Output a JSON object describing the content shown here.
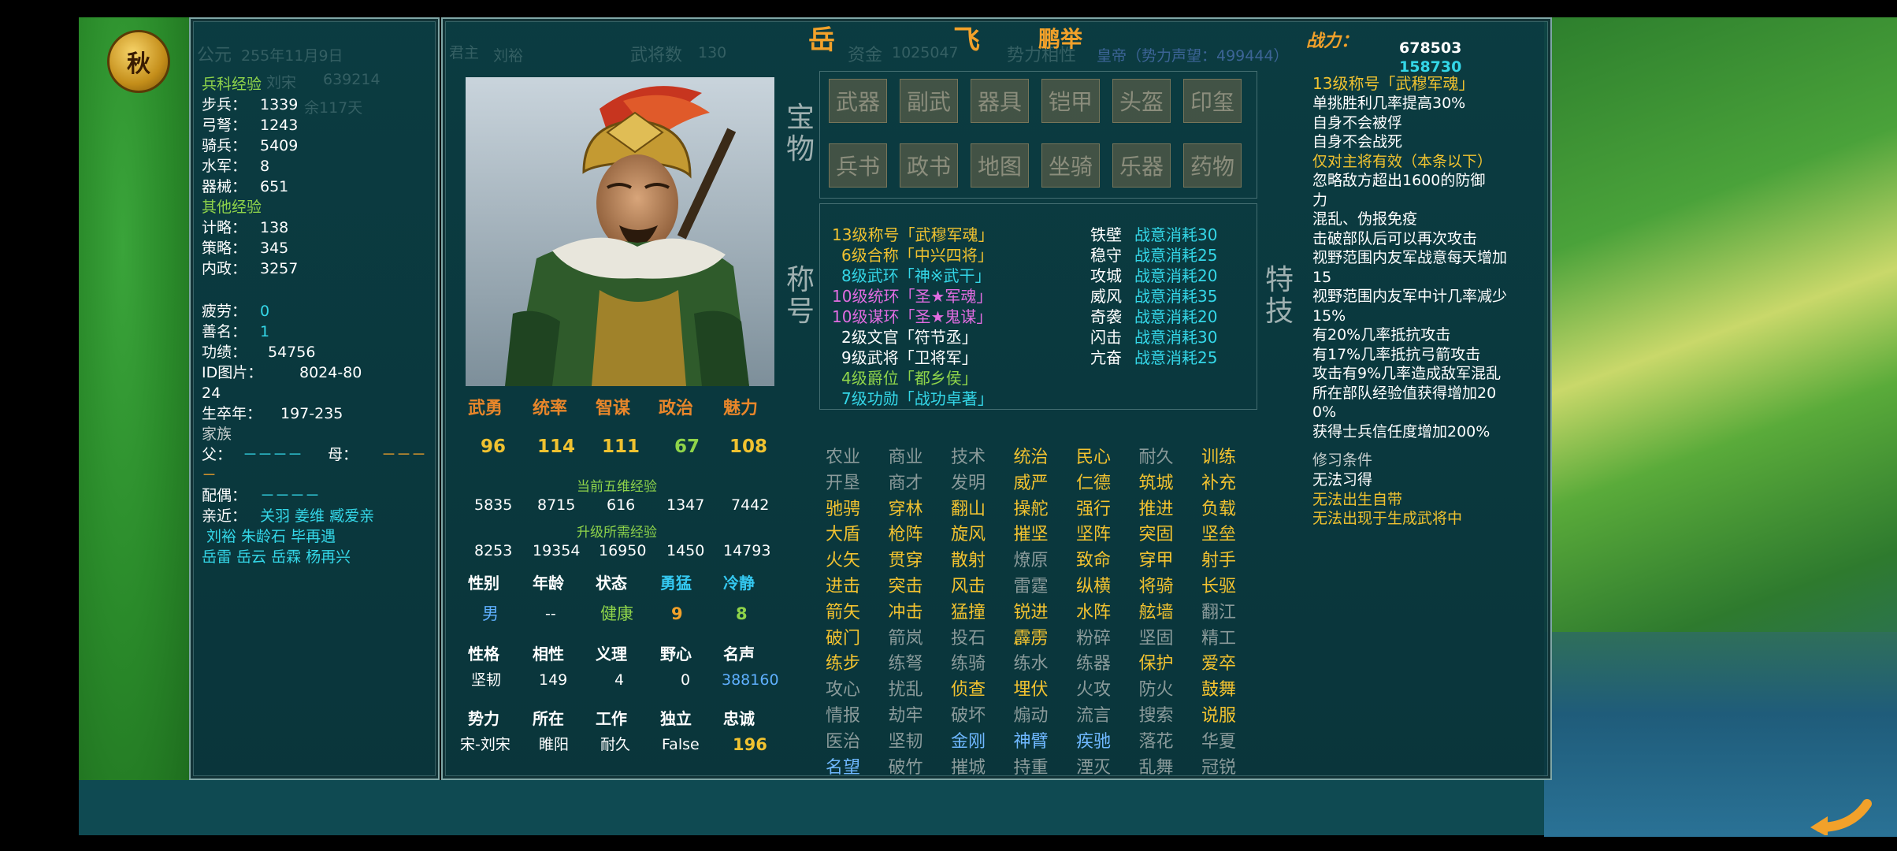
{
  "season": "秋",
  "date": {
    "label": "公元",
    "value": "255年11月9日"
  },
  "header": {
    "name_surname": "岳",
    "name_given": "飞",
    "courtesy": "鹏举",
    "combat_power_label": "战力：",
    "combat_power": "678503",
    "combat_power_2": "158730"
  },
  "ghost_text": {
    "lord": "君主",
    "lord_name": "刘裕",
    "generals_label": "武将数",
    "generals": "130",
    "funds_label": "资金",
    "funds": "1025047",
    "force_label": "势力相性",
    "title": "皇帝（势力声望：499444）",
    "small1": "刘宋",
    "small2": "639214",
    "small3": "余117天"
  },
  "left_panel": {
    "branch_exp_title": "兵科经验",
    "branches": [
      {
        "label": "步兵：",
        "value": "1339"
      },
      {
        "label": "弓弩：",
        "value": "1243"
      },
      {
        "label": "骑兵：",
        "value": "5409"
      },
      {
        "label": "水军：",
        "value": "8"
      },
      {
        "label": "器械：",
        "value": "651"
      }
    ],
    "other_exp_title": "其他经验",
    "others": [
      {
        "label": "计略：",
        "value": "138"
      },
      {
        "label": "策略：",
        "value": "345"
      },
      {
        "label": "内政：",
        "value": "3257"
      }
    ],
    "fatigue_label": "疲劳：",
    "fatigue": "0",
    "fame_label": "善名：",
    "fame": "1",
    "merit_label": "功绩：",
    "merit": "54756",
    "id_label": "ID图片：",
    "id_value": "8024-80",
    "id_value2": "24",
    "birth_label": "生卒年：",
    "birth": "197-235",
    "family_label": "家族",
    "father_label": "父：",
    "father": "－－－－",
    "mother_label": "母：",
    "mother": "－－－",
    "mother2": "－",
    "spouse_label": "配偶：",
    "spouse": "－－－－",
    "close_label": "亲近：",
    "close_line1": "关羽 姜维 臧爱亲",
    "close_line2": "刘裕 朱龄石 毕再遇",
    "close_line3": "岳雷 岳云 岳霖 杨再兴"
  },
  "stats": {
    "names": [
      "武勇",
      "统率",
      "智谋",
      "政治",
      "魅力"
    ],
    "values": [
      "96",
      "114",
      "111",
      "67",
      "108"
    ],
    "current_exp_label": "当前五维经验",
    "current_exp": [
      "5835",
      "8715",
      "616",
      "1347",
      "7442"
    ],
    "needed_exp_label": "升级所需经验",
    "needed_exp": [
      "8253",
      "19354",
      "16950",
      "1450",
      "14793"
    ],
    "row1_labels": [
      "性别",
      "年龄",
      "状态",
      "勇猛",
      "冷静"
    ],
    "row1_values": [
      "男",
      "--",
      "健康",
      "9",
      "8"
    ],
    "row2_labels": [
      "性格",
      "相性",
      "义理",
      "野心",
      "名声"
    ],
    "row2_values": [
      "坚韧",
      "149",
      "4",
      "0",
      "388160"
    ],
    "row3_labels": [
      "势力",
      "所在",
      "工作",
      "独立",
      "忠诚"
    ],
    "row3_values": [
      "宋-刘宋",
      "睢阳",
      "耐久",
      "False",
      "196"
    ]
  },
  "treasure": {
    "label": "宝物",
    "row1": [
      "武器",
      "副武",
      "器具",
      "铠甲",
      "头盔",
      "印玺"
    ],
    "row2": [
      "兵书",
      "政书",
      "地图",
      "坐骑",
      "乐器",
      "药物"
    ]
  },
  "titles": {
    "label": "称号",
    "items": [
      {
        "text": "13级称号「武穆军魂」",
        "color": "#f0c230"
      },
      {
        "text": "6级合称「中兴四将」",
        "color": "#f0c230"
      },
      {
        "text": "8级武环「神※武干」",
        "color": "#34d7e8"
      },
      {
        "text": "10级统环「圣★军魂」",
        "color": "#e06ce0"
      },
      {
        "text": "10级谋环「圣★鬼谋」",
        "color": "#e06ce0"
      },
      {
        "text": "2级文官「符节丞」",
        "color": "#ffffff"
      },
      {
        "text": "9级武将「卫将军」",
        "color": "#ffffff"
      },
      {
        "text": "4级爵位「都乡侯」",
        "color": "#8fd44a"
      },
      {
        "text": "7级功勋「战功卓著」",
        "color": "#34d7e8"
      }
    ]
  },
  "specials": {
    "label": "特技",
    "items": [
      {
        "name": "铁壁",
        "cost": "战意消耗30"
      },
      {
        "name": "稳守",
        "cost": "战意消耗25"
      },
      {
        "name": "攻城",
        "cost": "战意消耗20"
      },
      {
        "name": "威风",
        "cost": "战意消耗35"
      },
      {
        "name": "奇袭",
        "cost": "战意消耗20"
      },
      {
        "name": "闪击",
        "cost": "战意消耗30"
      },
      {
        "name": "亢奋",
        "cost": "战意消耗25"
      }
    ]
  },
  "skills": [
    [
      {
        "t": "农业",
        "s": "off"
      },
      {
        "t": "商业",
        "s": "off"
      },
      {
        "t": "技术",
        "s": "off"
      },
      {
        "t": "统治",
        "s": "on"
      },
      {
        "t": "民心",
        "s": "on"
      },
      {
        "t": "耐久",
        "s": "off"
      },
      {
        "t": "训练",
        "s": "on"
      }
    ],
    [
      {
        "t": "开垦",
        "s": "off"
      },
      {
        "t": "商才",
        "s": "off"
      },
      {
        "t": "发明",
        "s": "off"
      },
      {
        "t": "威严",
        "s": "on"
      },
      {
        "t": "仁德",
        "s": "on"
      },
      {
        "t": "筑城",
        "s": "on"
      },
      {
        "t": "补充",
        "s": "on"
      }
    ],
    [
      {
        "t": "驰骋",
        "s": "on"
      },
      {
        "t": "穿林",
        "s": "on"
      },
      {
        "t": "翻山",
        "s": "on"
      },
      {
        "t": "操舵",
        "s": "on"
      },
      {
        "t": "强行",
        "s": "on"
      },
      {
        "t": "推进",
        "s": "on"
      },
      {
        "t": "负载",
        "s": "on"
      }
    ],
    [
      {
        "t": "大盾",
        "s": "on"
      },
      {
        "t": "枪阵",
        "s": "on"
      },
      {
        "t": "旋风",
        "s": "on"
      },
      {
        "t": "摧坚",
        "s": "on"
      },
      {
        "t": "坚阵",
        "s": "on"
      },
      {
        "t": "突固",
        "s": "on"
      },
      {
        "t": "坚垒",
        "s": "on"
      }
    ],
    [
      {
        "t": "火矢",
        "s": "on"
      },
      {
        "t": "贯穿",
        "s": "on"
      },
      {
        "t": "散射",
        "s": "on"
      },
      {
        "t": "燎原",
        "s": "off"
      },
      {
        "t": "致命",
        "s": "on"
      },
      {
        "t": "穿甲",
        "s": "on"
      },
      {
        "t": "射手",
        "s": "on"
      }
    ],
    [
      {
        "t": "进击",
        "s": "on"
      },
      {
        "t": "突击",
        "s": "on"
      },
      {
        "t": "风击",
        "s": "on"
      },
      {
        "t": "雷霆",
        "s": "off"
      },
      {
        "t": "纵横",
        "s": "on"
      },
      {
        "t": "将骑",
        "s": "on"
      },
      {
        "t": "长驱",
        "s": "on"
      }
    ],
    [
      {
        "t": "箭矢",
        "s": "on"
      },
      {
        "t": "冲击",
        "s": "on"
      },
      {
        "t": "猛撞",
        "s": "on"
      },
      {
        "t": "锐进",
        "s": "on"
      },
      {
        "t": "水阵",
        "s": "on"
      },
      {
        "t": "舷墙",
        "s": "on"
      },
      {
        "t": "翻江",
        "s": "off"
      }
    ],
    [
      {
        "t": "破门",
        "s": "on"
      },
      {
        "t": "箭岚",
        "s": "off"
      },
      {
        "t": "投石",
        "s": "off"
      },
      {
        "t": "霹雳",
        "s": "on"
      },
      {
        "t": "粉碎",
        "s": "off"
      },
      {
        "t": "坚固",
        "s": "off"
      },
      {
        "t": "精工",
        "s": "off"
      }
    ],
    [
      {
        "t": "练步",
        "s": "on"
      },
      {
        "t": "练弩",
        "s": "off"
      },
      {
        "t": "练骑",
        "s": "off"
      },
      {
        "t": "练水",
        "s": "off"
      },
      {
        "t": "练器",
        "s": "off"
      },
      {
        "t": "保护",
        "s": "on"
      },
      {
        "t": "爱卒",
        "s": "on"
      }
    ],
    [
      {
        "t": "攻心",
        "s": "off"
      },
      {
        "t": "扰乱",
        "s": "off"
      },
      {
        "t": "侦查",
        "s": "on"
      },
      {
        "t": "埋伏",
        "s": "on"
      },
      {
        "t": "火攻",
        "s": "off"
      },
      {
        "t": "防火",
        "s": "off"
      },
      {
        "t": "鼓舞",
        "s": "on"
      }
    ],
    [
      {
        "t": "情报",
        "s": "off"
      },
      {
        "t": "劫牢",
        "s": "off"
      },
      {
        "t": "破坏",
        "s": "off"
      },
      {
        "t": "煽动",
        "s": "off"
      },
      {
        "t": "流言",
        "s": "off"
      },
      {
        "t": "搜索",
        "s": "off"
      },
      {
        "t": "说服",
        "s": "on"
      }
    ],
    [
      {
        "t": "医治",
        "s": "off"
      },
      {
        "t": "坚韧",
        "s": "off"
      },
      {
        "t": "金刚",
        "s": "lb"
      },
      {
        "t": "神臂",
        "s": "lb"
      },
      {
        "t": "疾驰",
        "s": "lb"
      },
      {
        "t": "落花",
        "s": "off"
      },
      {
        "t": "华夏",
        "s": "off"
      }
    ],
    [
      {
        "t": "名望",
        "s": "lb"
      },
      {
        "t": "破竹",
        "s": "off"
      },
      {
        "t": "摧城",
        "s": "off"
      },
      {
        "t": "持重",
        "s": "off"
      },
      {
        "t": "湮灭",
        "s": "off"
      },
      {
        "t": "乱舞",
        "s": "off"
      },
      {
        "t": "冠锐",
        "s": "off"
      }
    ]
  ],
  "title_detail": {
    "heading": "13级称号「武穆军魂」",
    "lines": [
      {
        "text": "单挑胜利几率提高30%",
        "color": "#ffffff"
      },
      {
        "text": "自身不会被俘",
        "color": "#ffffff"
      },
      {
        "text": "自身不会战死",
        "color": "#ffffff"
      },
      {
        "text": "仅对主将有效（本条以下）",
        "color": "#f0c230"
      },
      {
        "text": "忽略敌方超出1600的防御",
        "color": "#ffffff"
      },
      {
        "text": "力",
        "color": "#ffffff"
      },
      {
        "text": "混乱、伪报免疫",
        "color": "#ffffff"
      },
      {
        "text": "击破部队后可以再次攻击",
        "color": "#ffffff"
      },
      {
        "text": "视野范围内友军战意每天增加",
        "color": "#ffffff"
      },
      {
        "text": "15",
        "color": "#ffffff"
      },
      {
        "text": "视野范围内友军中计几率减少",
        "color": "#ffffff"
      },
      {
        "text": "15%",
        "color": "#ffffff"
      },
      {
        "text": "有20%几率抵抗攻击",
        "color": "#ffffff"
      },
      {
        "text": "有17%几率抵抗弓箭攻击",
        "color": "#ffffff"
      },
      {
        "text": "攻击有9%几率造成敌军混乱",
        "color": "#ffffff"
      },
      {
        "text": "所在部队经验值获得增加20",
        "color": "#ffffff"
      },
      {
        "text": "0%",
        "color": "#ffffff"
      },
      {
        "text": "获得士兵信任度增加200%",
        "color": "#ffffff"
      }
    ],
    "cond_label": "修习条件",
    "conds": [
      {
        "text": "无法习得",
        "color": "#ffffff"
      },
      {
        "text": "无法出生自带",
        "color": "#f0c230"
      },
      {
        "text": "无法出现于生成武将中",
        "color": "#f0c230"
      }
    ]
  }
}
